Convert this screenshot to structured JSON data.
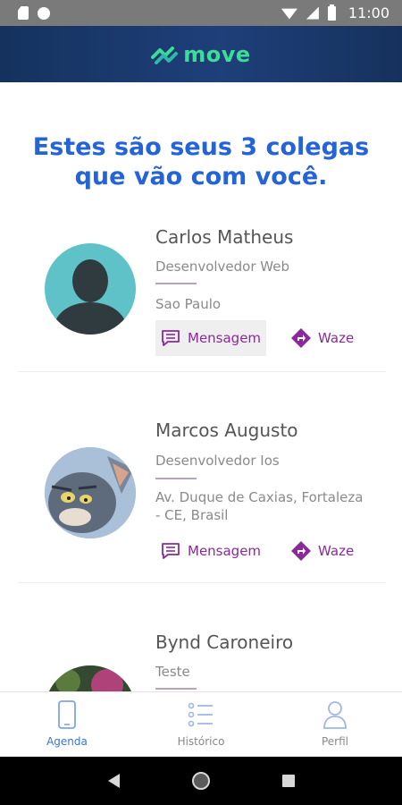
{
  "status_bar": {
    "time": "11:00"
  },
  "header": {
    "brand": "move"
  },
  "headline": {
    "line1": "Estes são seus 3 colegas",
    "line2": "que vão com você."
  },
  "colleagues": [
    {
      "name": "Carlos Matheus",
      "role": "Desenvolvedor Web",
      "location": "Sao Paulo",
      "message_label": "Mensagem",
      "waze_label": "Waze",
      "avatar": "default-silhouette-icon"
    },
    {
      "name": "Marcos Augusto",
      "role": "Desenvolvedor Ios",
      "location_line1": "Av. Duque de Caxias, Fortaleza",
      "location_line2": "- CE, Brasil",
      "message_label": "Mensagem",
      "waze_label": "Waze",
      "avatar": "cartoon-cat-photo"
    },
    {
      "name": "Bynd Caroneiro",
      "role": "Teste",
      "avatar": "photo"
    }
  ],
  "bottom_nav": [
    {
      "label": "Agenda",
      "icon": "phone-icon",
      "active": true
    },
    {
      "label": "Histórico",
      "icon": "list-icon",
      "active": false
    },
    {
      "label": "Perfil",
      "icon": "person-icon",
      "active": false
    }
  ],
  "colors": {
    "primary_blue": "#2563d8",
    "accent_purple": "#8a2a9a",
    "brand_green": "#3ddc97",
    "header_navy": "#1e3f7a"
  }
}
